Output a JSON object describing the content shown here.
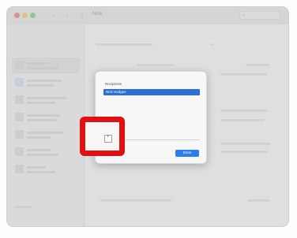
{
  "window": {
    "title": "Note"
  },
  "dialog": {
    "label": "Recipients",
    "selected_item": "Nick Hodges",
    "field_value": "",
    "action_button": "Done"
  },
  "highlight_target": {
    "glyph": "+"
  },
  "colors": {
    "accent": "#2f7cf0",
    "highlight_border": "#e11111"
  }
}
